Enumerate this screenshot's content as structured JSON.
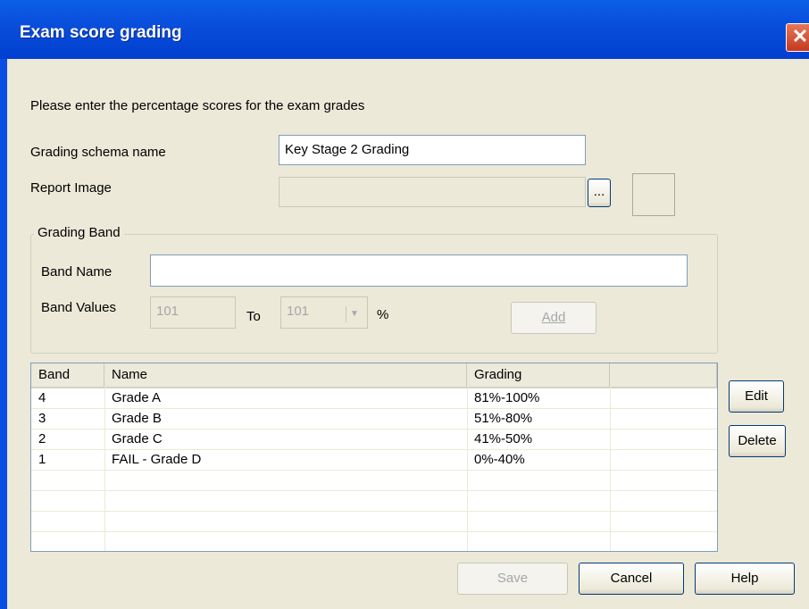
{
  "window": {
    "title": "Exam score grading",
    "close_glyph": "✕"
  },
  "form": {
    "instructions": "Please enter the percentage scores for the exam grades",
    "schema_name_label": "Grading schema name",
    "schema_name_value": "Key Stage 2 Grading",
    "report_image_label": "Report Image",
    "report_image_value": "",
    "browse_label": "..."
  },
  "grading_band": {
    "group_title": "Grading Band",
    "band_name_label": "Band Name",
    "band_name_value": "",
    "band_values_label": "Band Values",
    "from_value": "101",
    "to_label": "To",
    "to_value": "101",
    "percent_label": "%",
    "add_label": "Add"
  },
  "table": {
    "columns": [
      "Band",
      "Name",
      "Grading",
      ""
    ],
    "rows": [
      {
        "band": "4",
        "name": "Grade A",
        "grading": "81%-100%"
      },
      {
        "band": "3",
        "name": "Grade B",
        "grading": "51%-80%"
      },
      {
        "band": "2",
        "name": "Grade C",
        "grading": "41%-50%"
      },
      {
        "band": "1",
        "name": "FAIL - Grade D",
        "grading": "0%-40%"
      }
    ]
  },
  "side_buttons": {
    "edit_label": "Edit",
    "delete_label": "Delete"
  },
  "footer": {
    "save_label": "Save",
    "cancel_label": "Cancel",
    "help_label": "Help"
  },
  "colors": {
    "titlebar": "#0a4edc",
    "dialog_bg": "#ece9d8",
    "close_button": "#c5391d"
  }
}
